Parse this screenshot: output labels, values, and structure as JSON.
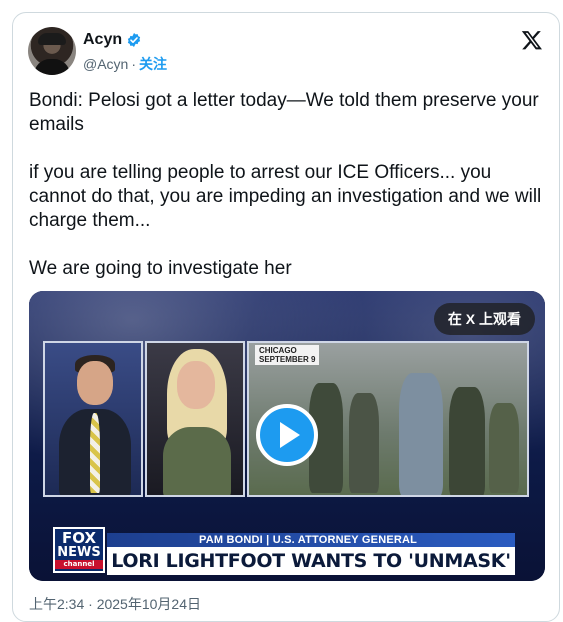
{
  "tweet": {
    "display_name": "Acyn",
    "handle": "@Acyn",
    "separator": "·",
    "follow_label": "关注",
    "body": "Bondi: Pelosi got a letter today—We told them preserve your emails\n\nif you are telling people to arrest our ICE Officers... you cannot do that, you are impeding an investigation and we will charge them...\n\nWe are going to investigate her",
    "timestamp": "上午2:34 · 2025年10月24日"
  },
  "media": {
    "watch_label": "在 X 上观看",
    "location_tag": "CHICAGO\nSEPTEMBER 9",
    "fox_logo": [
      "FOX",
      "NEWS",
      "channel"
    ],
    "name_strip": "PAM BONDI | U.S. ATTORNEY GENERAL",
    "headline": "LORI LIGHTFOOT WANTS TO 'UNMASK' ICE"
  },
  "icons": {
    "verified": "verified-badge-icon",
    "logo": "x-logo-icon",
    "play": "play-icon"
  },
  "colors": {
    "accent": "#1d9bf0",
    "text": "#0f1419",
    "muted": "#536471",
    "fox_blue": "#0b2a6b"
  }
}
